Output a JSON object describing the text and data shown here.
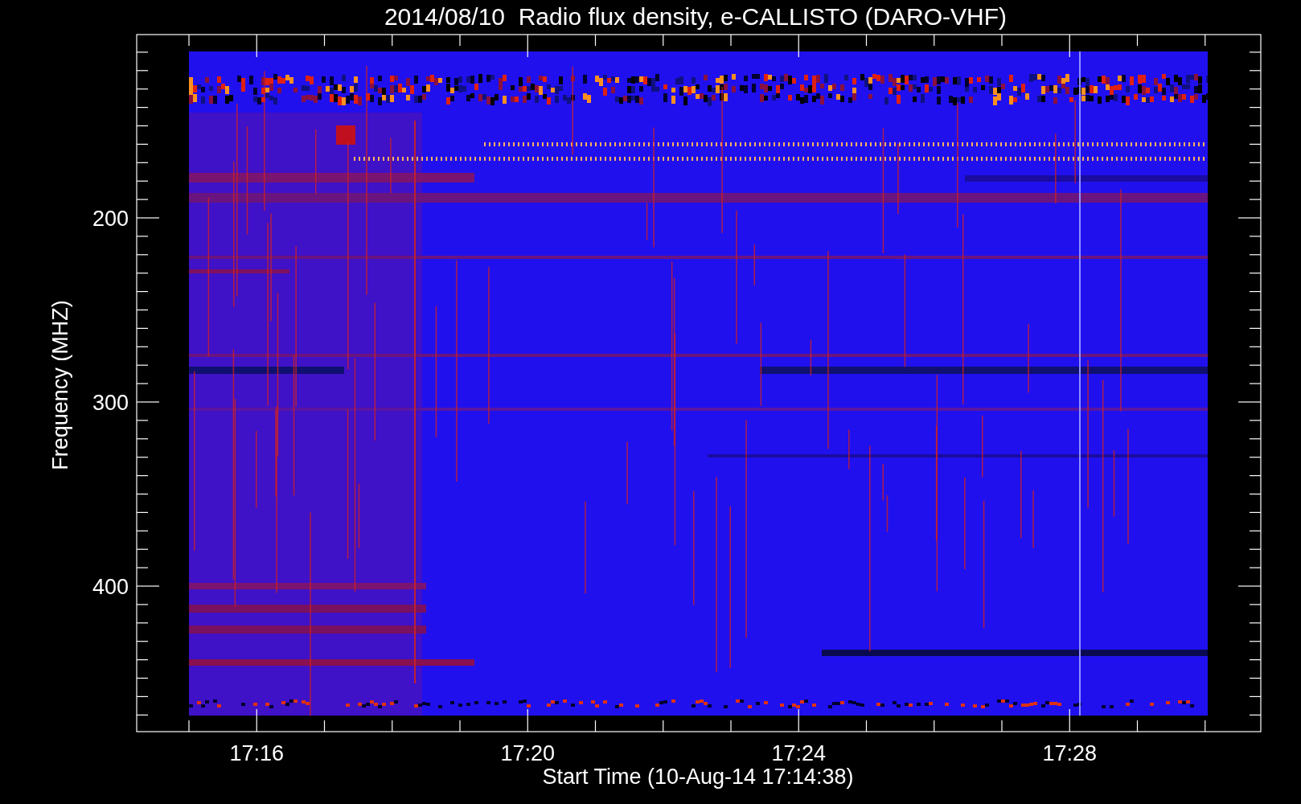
{
  "title": "2014/08/10  Radio flux density, e-CALLISTO (DARO-VHF)",
  "plot": {
    "ylabel": "Frequency (MHZ)",
    "xlabel": "Start Time (10-Aug-14 17:14:38)",
    "yticks": [
      "200",
      "300",
      "400"
    ],
    "xticks": [
      "17:16",
      "17:20",
      "17:24",
      "17:28"
    ]
  }
}
